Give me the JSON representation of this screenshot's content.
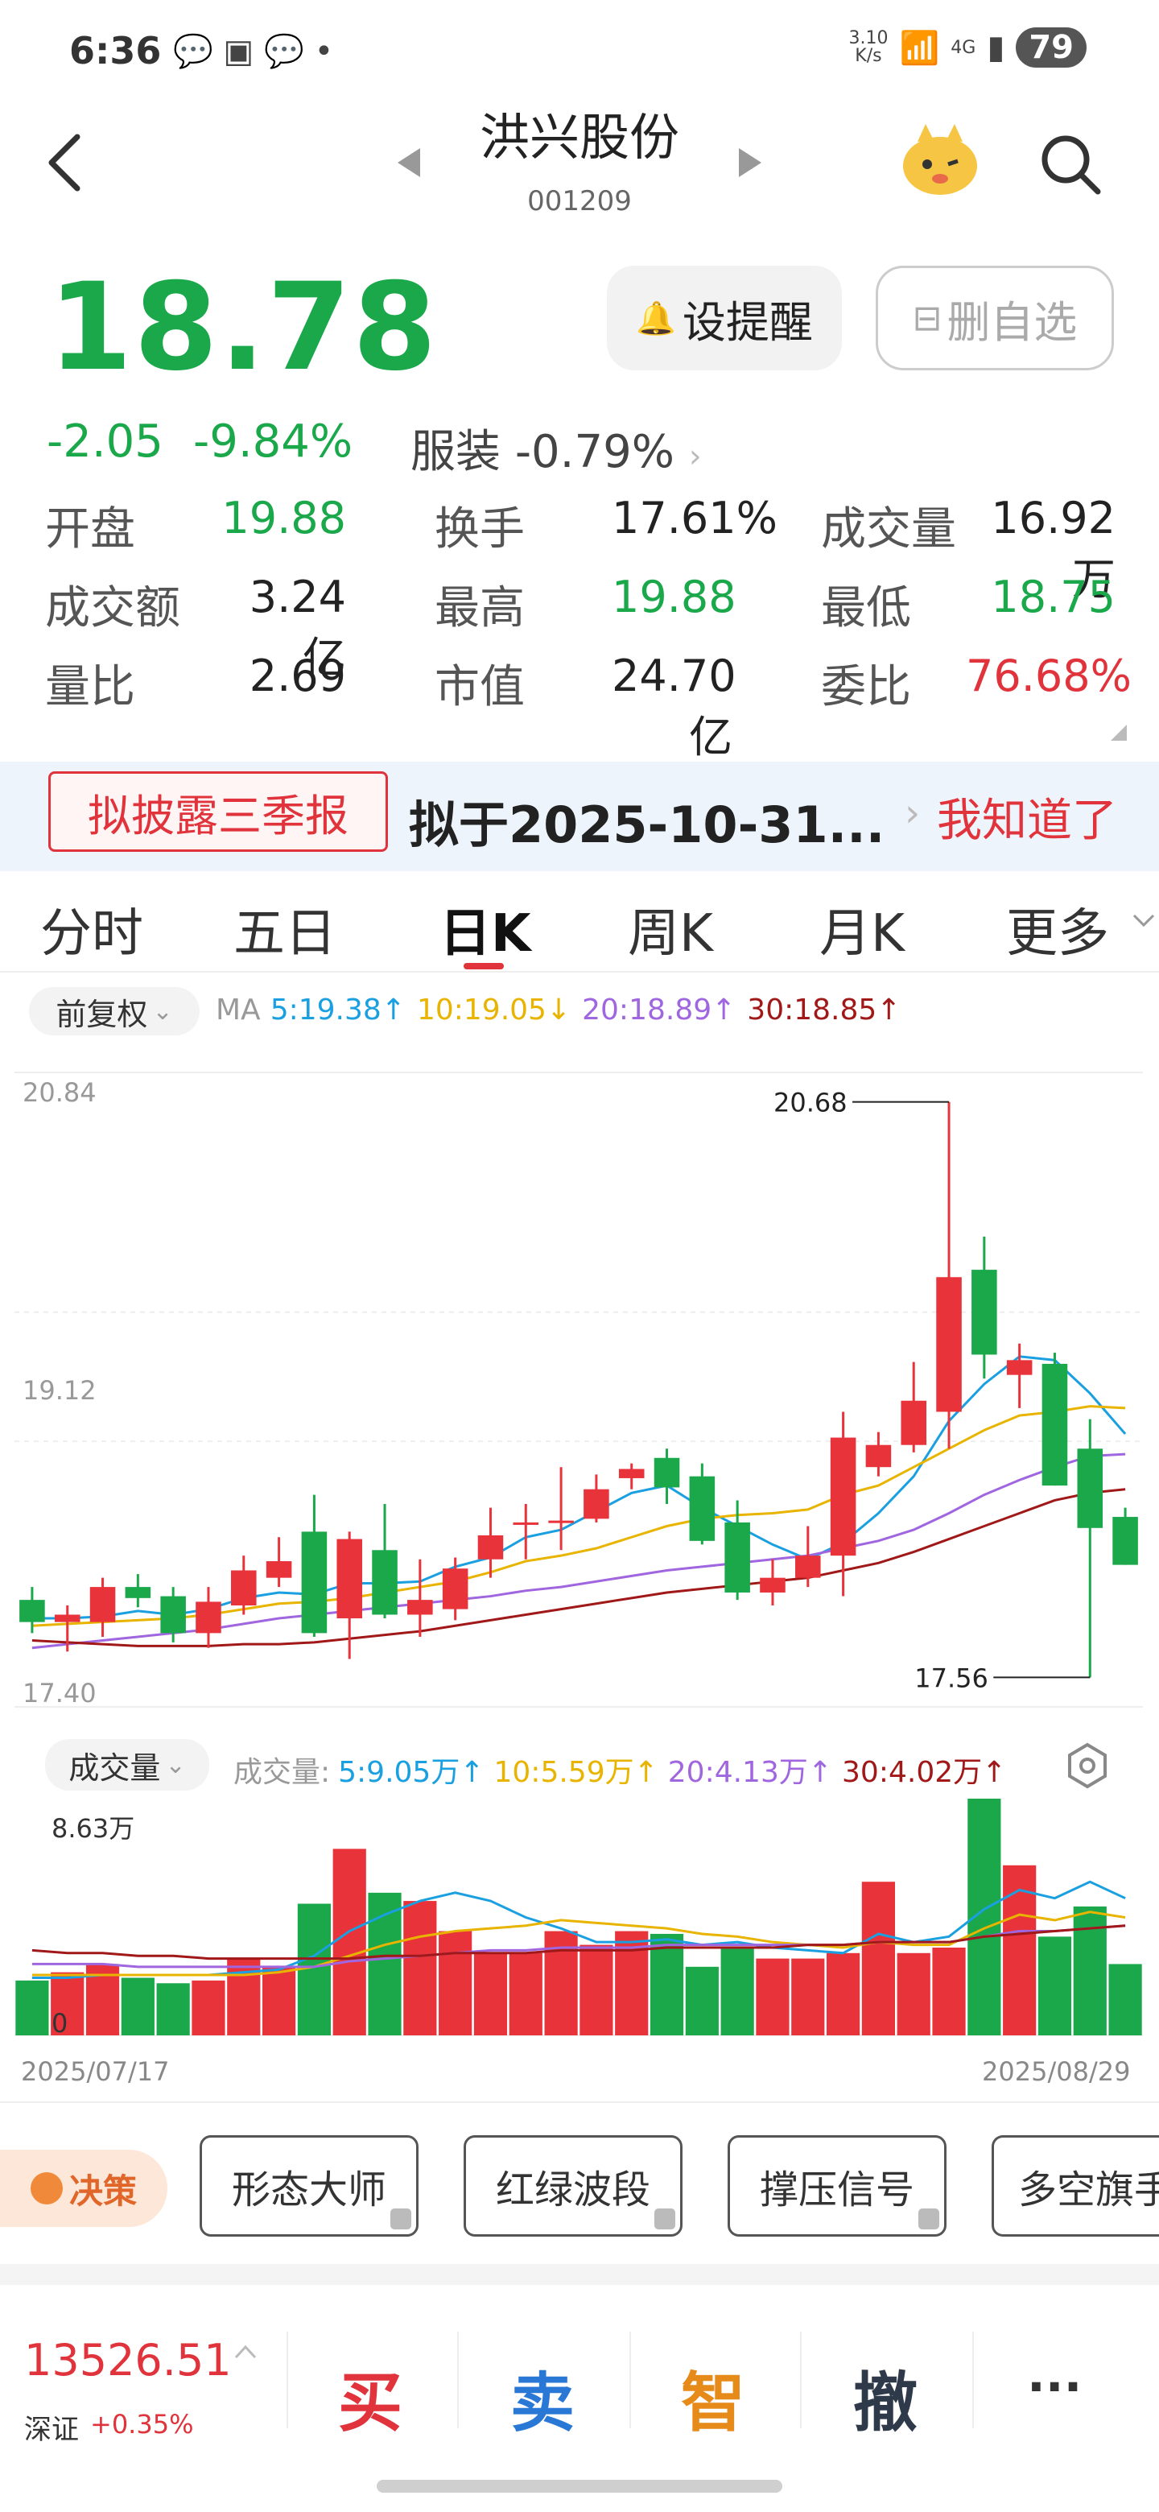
{
  "status_bar": {
    "time": "6:36",
    "speed": "3.10\nK/s",
    "network": "4G",
    "battery": "79"
  },
  "header": {
    "stock_name": "洪兴股份",
    "stock_code": "001209"
  },
  "quote": {
    "price": "18.78",
    "change": "-2.05",
    "change_pct": "-9.84%",
    "sector_name": "服装",
    "sector_chg": "-0.79%",
    "remind_label": "设提醒",
    "delete_label": "删自选",
    "stats": [
      {
        "label": "开盘",
        "value": "19.88",
        "color": "#1aa84b"
      },
      {
        "label": "换手",
        "value": "17.61%",
        "color": "#222222"
      },
      {
        "label": "成交量",
        "value": "16.92万",
        "color": "#222222"
      },
      {
        "label": "成交额",
        "value": "3.24亿",
        "color": "#222222"
      },
      {
        "label": "最高",
        "value": "19.88",
        "color": "#1aa84b"
      },
      {
        "label": "最低",
        "value": "18.75",
        "color": "#1aa84b"
      },
      {
        "label": "量比",
        "value": "2.69",
        "color": "#222222"
      },
      {
        "label": "市值",
        "value": "24.70亿",
        "color": "#222222"
      },
      {
        "label": "委比",
        "value": "76.68%",
        "color": "#e0333b"
      }
    ]
  },
  "banner": {
    "tag": "拟披露三季报",
    "text": "拟于2025-10-31...",
    "action": "我知道了"
  },
  "tabs": [
    "分时",
    "五日",
    "日K",
    "周K",
    "月K",
    "更多"
  ],
  "active_tab": "日K",
  "kline": {
    "adjust_label": "前复权",
    "ma_title": "MA",
    "ma": [
      {
        "label": "5:19.38↑",
        "color": "#1aa0e0"
      },
      {
        "label": "10:19.05↓",
        "color": "#e8b400"
      },
      {
        "label": "20:18.89↑",
        "color": "#a066e0"
      },
      {
        "label": "30:18.85↑",
        "color": "#a01818"
      }
    ],
    "vol_title": "成交量",
    "vol_prefix": "成交量:",
    "vol_ma": [
      {
        "label": "5:9.05万↑",
        "color": "#1aa0e0"
      },
      {
        "label": "10:5.59万↑",
        "color": "#e8b400"
      },
      {
        "label": "20:4.13万↑",
        "color": "#a066e0"
      },
      {
        "label": "30:4.02万↑",
        "color": "#a01818"
      }
    ],
    "vol_max_label": "8.63万",
    "vol_zero_label": "0",
    "start_date": "2025/07/17",
    "end_date": "2025/08/29"
  },
  "chart_data": {
    "type": "candlestick",
    "y_axis_labels": [
      "20.84",
      "19.12",
      "17.40"
    ],
    "ylim": [
      17.4,
      20.84
    ],
    "high_marker": "20.68",
    "low_marker": "17.56",
    "candles": [
      {
        "o": 17.98,
        "c": 17.86,
        "h": 18.05,
        "l": 17.8
      },
      {
        "o": 17.86,
        "c": 17.9,
        "h": 17.95,
        "l": 17.7
      },
      {
        "o": 17.86,
        "c": 18.05,
        "h": 18.1,
        "l": 17.78
      },
      {
        "o": 18.05,
        "c": 17.99,
        "h": 18.12,
        "l": 17.94
      },
      {
        "o": 18.0,
        "c": 17.8,
        "h": 18.05,
        "l": 17.75
      },
      {
        "o": 17.8,
        "c": 17.97,
        "h": 18.05,
        "l": 17.72
      },
      {
        "o": 17.95,
        "c": 18.14,
        "h": 18.22,
        "l": 17.9
      },
      {
        "o": 18.1,
        "c": 18.19,
        "h": 18.32,
        "l": 18.05
      },
      {
        "o": 18.35,
        "c": 17.8,
        "h": 18.55,
        "l": 17.78
      },
      {
        "o": 17.88,
        "c": 18.31,
        "h": 18.35,
        "l": 17.66
      },
      {
        "o": 18.25,
        "c": 17.9,
        "h": 18.5,
        "l": 17.88
      },
      {
        "o": 17.9,
        "c": 17.98,
        "h": 18.2,
        "l": 17.78
      },
      {
        "o": 17.93,
        "c": 18.15,
        "h": 18.21,
        "l": 17.87
      },
      {
        "o": 18.2,
        "c": 18.33,
        "h": 18.48,
        "l": 18.1
      },
      {
        "o": 18.4,
        "c": 18.4,
        "h": 18.5,
        "l": 18.2
      },
      {
        "o": 18.4,
        "c": 18.41,
        "h": 18.7,
        "l": 18.25
      },
      {
        "o": 18.42,
        "c": 18.58,
        "h": 18.66,
        "l": 18.4
      },
      {
        "o": 18.64,
        "c": 18.69,
        "h": 18.72,
        "l": 18.58
      },
      {
        "o": 18.75,
        "c": 18.59,
        "h": 18.8,
        "l": 18.5
      },
      {
        "o": 18.65,
        "c": 18.3,
        "h": 18.72,
        "l": 18.28
      },
      {
        "o": 18.4,
        "c": 18.02,
        "h": 18.52,
        "l": 17.98
      },
      {
        "o": 18.02,
        "c": 18.1,
        "h": 18.2,
        "l": 17.95
      },
      {
        "o": 18.1,
        "c": 18.22,
        "h": 18.38,
        "l": 18.05
      },
      {
        "o": 18.22,
        "c": 18.86,
        "h": 19.0,
        "l": 18.0
      },
      {
        "o": 18.7,
        "c": 18.82,
        "h": 18.89,
        "l": 18.65
      },
      {
        "o": 18.82,
        "c": 19.06,
        "h": 19.27,
        "l": 18.78
      },
      {
        "o": 19.0,
        "c": 19.73,
        "h": 20.68,
        "l": 18.8
      },
      {
        "o": 19.77,
        "c": 19.31,
        "h": 19.95,
        "l": 19.18
      },
      {
        "o": 19.2,
        "c": 19.28,
        "h": 19.37,
        "l": 19.02
      },
      {
        "o": 19.26,
        "c": 18.6,
        "h": 19.32,
        "l": 18.6
      },
      {
        "o": 18.8,
        "c": 18.37,
        "h": 18.96,
        "l": 17.56
      },
      {
        "o": 18.43,
        "c": 18.17,
        "h": 18.48,
        "l": 18.17
      }
    ],
    "ma_series": [
      {
        "name": "MA5",
        "color": "#1aa0e0",
        "values": [
          17.88,
          17.88,
          17.89,
          17.92,
          17.9,
          17.93,
          17.99,
          18.02,
          18.01,
          18.07,
          18.07,
          18.08,
          18.16,
          18.21,
          18.32,
          18.36,
          18.46,
          18.56,
          18.6,
          18.48,
          18.38,
          18.28,
          18.2,
          18.29,
          18.45,
          18.65,
          18.95,
          19.15,
          19.3,
          19.28,
          19.1,
          18.88
        ]
      },
      {
        "name": "MA10",
        "color": "#e8b400",
        "values": [
          17.84,
          17.85,
          17.86,
          17.87,
          17.88,
          17.9,
          17.93,
          17.96,
          17.97,
          17.99,
          18.02,
          18.05,
          18.08,
          18.13,
          18.19,
          18.22,
          18.26,
          18.32,
          18.38,
          18.42,
          18.44,
          18.45,
          18.47,
          18.55,
          18.6,
          18.7,
          18.8,
          18.9,
          18.98,
          19.0,
          19.03,
          19.02
        ]
      },
      {
        "name": "MA20",
        "color": "#a066e0",
        "values": [
          17.72,
          17.74,
          17.76,
          17.78,
          17.8,
          17.82,
          17.85,
          17.88,
          17.9,
          17.92,
          17.94,
          17.96,
          17.98,
          18.0,
          18.03,
          18.05,
          18.08,
          18.11,
          18.14,
          18.16,
          18.18,
          18.2,
          18.22,
          18.26,
          18.3,
          18.36,
          18.45,
          18.55,
          18.63,
          18.7,
          18.76,
          18.77
        ]
      },
      {
        "name": "MA30",
        "color": "#a01818",
        "values": [
          17.76,
          17.75,
          17.74,
          17.73,
          17.73,
          17.73,
          17.74,
          17.74,
          17.75,
          17.77,
          17.79,
          17.81,
          17.84,
          17.87,
          17.9,
          17.93,
          17.96,
          17.99,
          18.02,
          18.04,
          18.06,
          18.08,
          18.1,
          18.14,
          18.18,
          18.24,
          18.31,
          18.38,
          18.45,
          18.52,
          18.56,
          18.58
        ]
      }
    ],
    "volume": [
      2.0,
      2.3,
      2.6,
      2.1,
      1.9,
      2.0,
      2.8,
      2.5,
      4.8,
      6.8,
      5.2,
      4.9,
      3.8,
      3.0,
      3.0,
      3.8,
      3.3,
      3.8,
      3.7,
      2.5,
      3.2,
      2.8,
      2.8,
      3.0,
      5.6,
      3.0,
      3.2,
      8.63,
      6.2,
      3.6,
      4.7,
      2.6
    ],
    "vol_ylim": [
      0,
      8.63
    ],
    "vol_ma_series": [
      {
        "name": "MA5",
        "color": "#1aa0e0",
        "values": [
          2.1,
          2.1,
          2.2,
          2.2,
          2.2,
          2.2,
          2.3,
          2.4,
          2.9,
          3.8,
          4.4,
          4.9,
          5.2,
          4.9,
          4.3,
          3.9,
          3.4,
          3.4,
          3.5,
          3.3,
          3.4,
          3.2,
          3.1,
          3.0,
          3.7,
          3.4,
          3.6,
          4.6,
          5.3,
          5.0,
          5.6,
          5.0
        ]
      },
      {
        "name": "MA10",
        "color": "#e8b400",
        "values": [
          2.2,
          2.2,
          2.2,
          2.2,
          2.2,
          2.2,
          2.2,
          2.3,
          2.5,
          2.9,
          3.3,
          3.6,
          3.8,
          3.9,
          4.0,
          4.2,
          4.1,
          4.0,
          3.9,
          3.7,
          3.6,
          3.4,
          3.3,
          3.2,
          3.4,
          3.3,
          3.3,
          3.9,
          4.4,
          4.2,
          4.5,
          4.3
        ]
      },
      {
        "name": "MA20",
        "color": "#a066e0",
        "values": [
          2.6,
          2.6,
          2.6,
          2.5,
          2.5,
          2.5,
          2.5,
          2.5,
          2.5,
          2.7,
          2.8,
          2.9,
          3.0,
          3.1,
          3.1,
          3.2,
          3.2,
          3.2,
          3.3,
          3.3,
          3.3,
          3.3,
          3.3,
          3.3,
          3.4,
          3.4,
          3.4,
          3.6,
          3.8,
          3.8,
          3.9,
          4.0
        ]
      },
      {
        "name": "MA30",
        "color": "#a01818",
        "values": [
          3.1,
          3.0,
          3.0,
          2.9,
          2.9,
          2.8,
          2.8,
          2.8,
          2.8,
          2.8,
          2.9,
          2.9,
          3.0,
          3.0,
          3.0,
          3.1,
          3.1,
          3.1,
          3.2,
          3.2,
          3.2,
          3.2,
          3.3,
          3.3,
          3.4,
          3.4,
          3.4,
          3.6,
          3.7,
          3.8,
          3.9,
          4.0
        ]
      }
    ]
  },
  "strategy": {
    "brand": "决策",
    "buttons": [
      "形态大师",
      "红绿波段",
      "撑压信号",
      "多空旗手"
    ]
  },
  "bottom": {
    "index_value": "13526.51",
    "index_name": "深证",
    "index_chg": "+0.35%",
    "actions": [
      {
        "label": "买",
        "color": "#e0333b"
      },
      {
        "label": "卖",
        "color": "#2a78d6"
      },
      {
        "label": "智",
        "color": "#e68a1a"
      },
      {
        "label": "撤",
        "color": "#2e3a4a"
      },
      {
        "label": "···",
        "color": "#333333"
      }
    ]
  }
}
